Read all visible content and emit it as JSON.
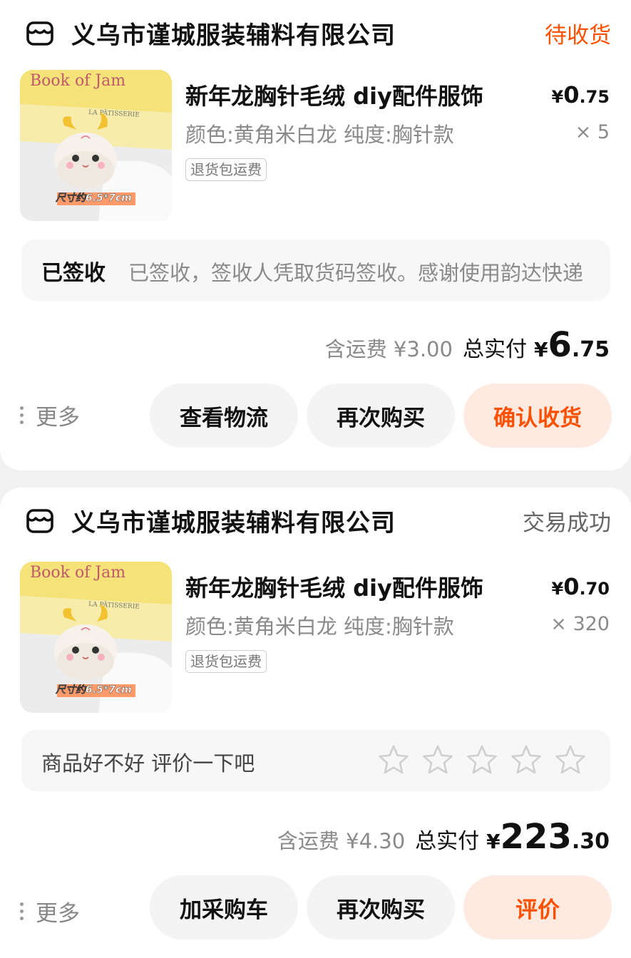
{
  "orders": [
    {
      "shop_name": "义乌市谨城服装辅料有限公司",
      "status": "待收货",
      "product": {
        "image_text": "Book of Jam · LA PÂTISSERIE · 尺寸约6.5*7cm",
        "title": "新年龙胸针毛绒 diy配件服饰",
        "spec": "颜色:黄角米白龙 纯度:胸针款",
        "tag": "退货包运费",
        "price_symbol": "¥",
        "price_int": "0",
        "price_dec": ".75",
        "qty": "× 5"
      },
      "logistics": {
        "label": "已签收",
        "text": "已签收，签收人凭取货码签收。感谢使用韵达快递"
      },
      "total": {
        "shipping": "含运费 ¥3.00",
        "paid_label": "总实付",
        "yen": "¥",
        "int": "6",
        "dec": ".75"
      },
      "more_label": "更多",
      "buttons": [
        "查看物流",
        "再次购买",
        "确认收货"
      ]
    },
    {
      "shop_name": "义乌市谨城服装辅料有限公司",
      "status": "交易成功",
      "product": {
        "image_text": "Book of Jam · LA PÂTISSERIE · 尺寸约6.5*7cm",
        "title": "新年龙胸针毛绒 diy配件服饰",
        "spec": "颜色:黄角米白龙 纯度:胸针款",
        "tag": "退货包运费",
        "price_symbol": "¥",
        "price_int": "0",
        "price_dec": ".70",
        "qty": "× 320"
      },
      "review": {
        "prompt": "商品好不好 评价一下吧",
        "stars": 5,
        "rating": 0
      },
      "total": {
        "shipping": "含运费 ¥4.30",
        "paid_label": "总实付",
        "yen": "¥",
        "int": "223",
        "dec": ".30"
      },
      "more_label": "更多",
      "buttons": [
        "加采购车",
        "再次购买",
        "评价"
      ]
    }
  ],
  "colors": {
    "accent": "#ff5000",
    "accent_bg": "#ffeae1",
    "page_bg": "#f2f2f2"
  }
}
